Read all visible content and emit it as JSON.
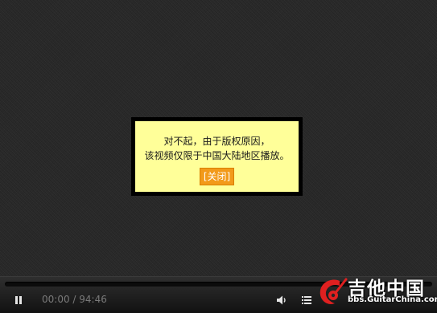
{
  "notice": {
    "line1": "对不起，由于版权原因，",
    "line2": "该视频仅限于中国大陆地区播放。",
    "close_label": "[关闭]"
  },
  "controls": {
    "time": "00:00 / 94:46",
    "play_icon": "pause-icon",
    "volume_icon": "speaker-icon",
    "playlist_icon": "list-icon",
    "progress": 0
  },
  "watermark": {
    "title": "吉他中国",
    "url": "bbs.GuitarChina.com",
    "logo_icon": "guitar-logo-icon"
  },
  "colors": {
    "notice_bg": "#ffff99",
    "close_button_bg": "#f29a1a",
    "brand_red": "#e02020"
  }
}
